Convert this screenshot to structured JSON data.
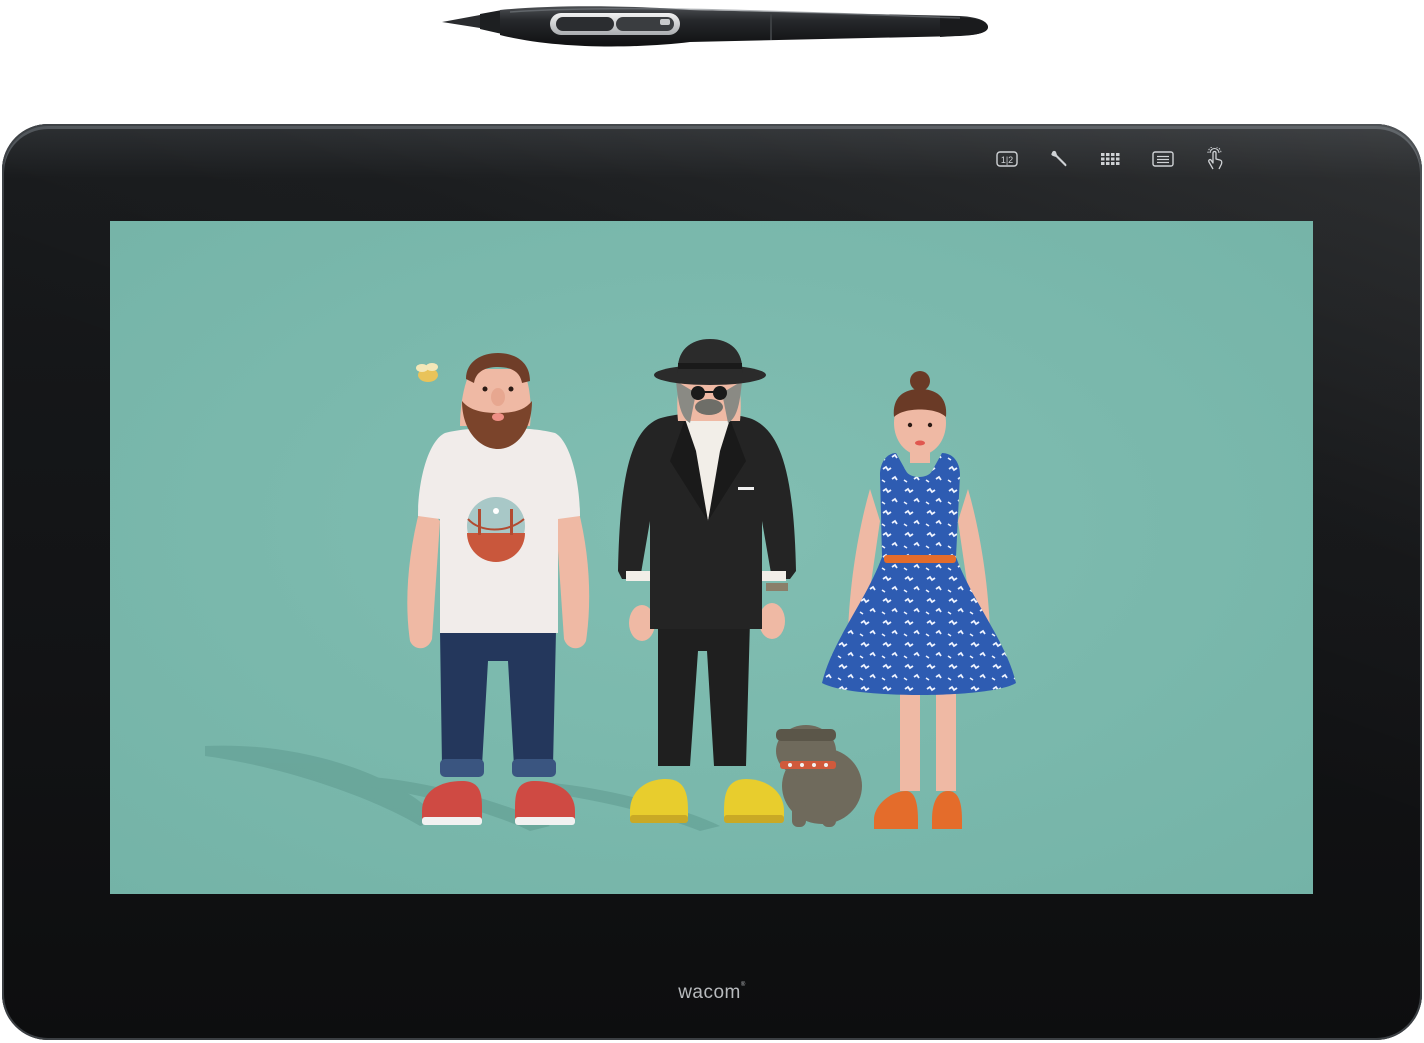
{
  "brand": {
    "logo_text": "wacom"
  },
  "express_keys": [
    {
      "name": "display-toggle",
      "icon": "display-toggle-icon",
      "label": "1|2"
    },
    {
      "name": "settings",
      "icon": "wrench-icon"
    },
    {
      "name": "keyboard",
      "icon": "keyboard-icon"
    },
    {
      "name": "menu",
      "icon": "menu-icon"
    },
    {
      "name": "touch-toggle",
      "icon": "touch-icon"
    }
  ],
  "pen": {
    "icon": "pen-stylus-icon"
  },
  "screen": {
    "background_color": "#79b7ab",
    "scene": "three-characters-with-dog"
  },
  "colors": {
    "bezel": "#141517",
    "screen_bg": "#79b7ab"
  }
}
